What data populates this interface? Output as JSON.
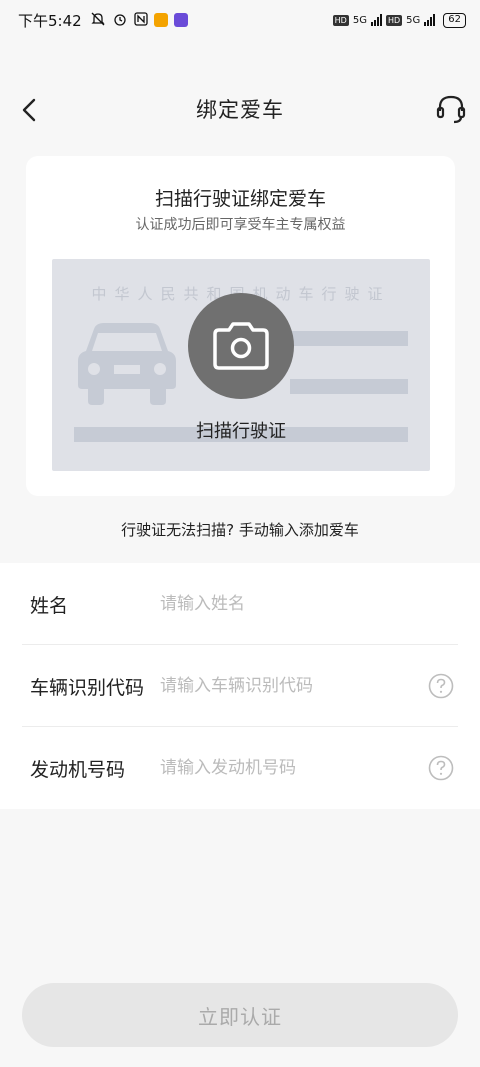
{
  "status_bar": {
    "time": "下午5:42",
    "hd1": "HD",
    "net1": "5G",
    "hd2": "HD",
    "net2": "5G",
    "battery": "62"
  },
  "header": {
    "title": "绑定爱车",
    "back_icon": "chevron-left-icon",
    "service_icon": "headset-icon"
  },
  "scan_card": {
    "title": "扫描行驶证绑定爱车",
    "subtitle": "认证成功后即可享受车主专属权益",
    "license_header": "中华人民共和国机动车行驶证",
    "scan_label": "扫描行驶证",
    "camera_icon": "camera-icon"
  },
  "manual_link": "行驶证无法扫描? 手动输入添加爱车",
  "form": {
    "fields": [
      {
        "label": "姓名",
        "placeholder": "请输入姓名",
        "value": ""
      },
      {
        "label": "车辆识别代码",
        "placeholder": "请输入车辆识别代码",
        "value": ""
      },
      {
        "label": "发动机号码",
        "placeholder": "请输入发动机号码",
        "value": ""
      }
    ],
    "help_icon": "question-circle-icon"
  },
  "submit": {
    "label": "立即认证"
  },
  "colors": {
    "background": "#f7f7f7",
    "card": "#ffffff",
    "license_bg": "#dfe1e7",
    "camera_circle": "#707070",
    "button_disabled": "#e6e6e6",
    "button_text_disabled": "#aaaaaa",
    "placeholder": "#bbbbbb"
  }
}
